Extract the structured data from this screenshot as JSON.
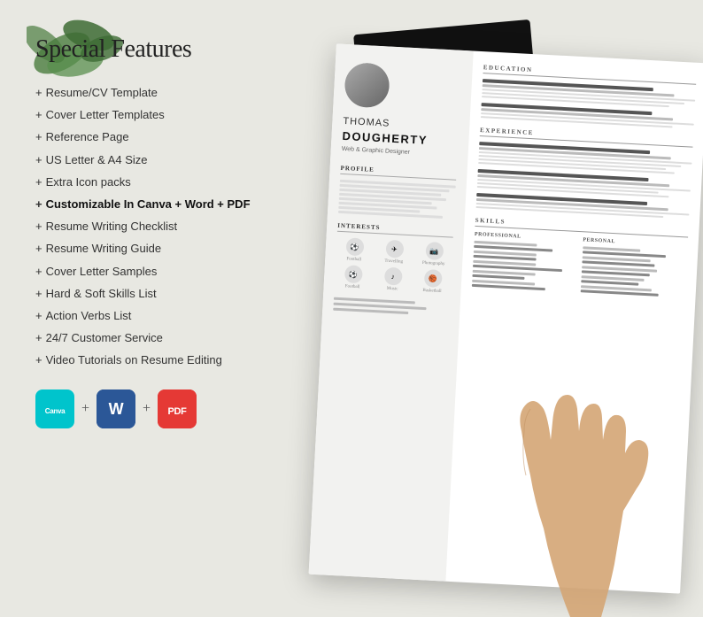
{
  "page": {
    "title": "Special Features",
    "background_color": "#e8e6df"
  },
  "features": {
    "section_title": "Special Features",
    "items": [
      {
        "id": 1,
        "text": "Resume/CV Template",
        "bold": false
      },
      {
        "id": 2,
        "text": "Cover Letter Templates",
        "bold": false
      },
      {
        "id": 3,
        "text": "Reference Page",
        "bold": false
      },
      {
        "id": 4,
        "text": "US Letter & A4 Size",
        "bold": false
      },
      {
        "id": 5,
        "text": "Extra Icon packs",
        "bold": false
      },
      {
        "id": 6,
        "text": "Customizable In Canva + Word + PDF",
        "bold": true
      },
      {
        "id": 7,
        "text": "Resume Writing Checklist",
        "bold": false
      },
      {
        "id": 8,
        "text": "Resume Writing Guide",
        "bold": false
      },
      {
        "id": 9,
        "text": "Cover Letter Samples",
        "bold": false
      },
      {
        "id": 10,
        "text": "Hard & Soft Skills List",
        "bold": false
      },
      {
        "id": 11,
        "text": "Action Verbs List",
        "bold": false
      },
      {
        "id": 12,
        "text": "24/7 Customer Service",
        "bold": false
      },
      {
        "id": 13,
        "text": "Video Tutorials on Resume Editing",
        "bold": false
      }
    ]
  },
  "tools": {
    "canva_label": "Canva",
    "word_label": "W",
    "pdf_label": "PDF",
    "plus_symbol": "+"
  },
  "resume": {
    "first_name": "THOMAS",
    "last_name": "DOUGHERTY",
    "title": "Web & Graphic Designer",
    "sections": {
      "profile": "PROFILE",
      "education": "EDUCATION",
      "experience": "EXPERIENCE",
      "skills": "SKILLS",
      "interests": "INTERESTS",
      "personal": "PERSONAL",
      "professional": "PROFESSIONAL"
    },
    "interests": [
      {
        "label": "Football",
        "icon": "⚽"
      },
      {
        "label": "Travelling",
        "icon": "✈"
      },
      {
        "label": "Photography",
        "icon": "📷"
      },
      {
        "label": "Football",
        "icon": "⚽"
      },
      {
        "label": "Music",
        "icon": "♪"
      },
      {
        "label": "Basketball",
        "icon": "🏀"
      }
    ]
  }
}
